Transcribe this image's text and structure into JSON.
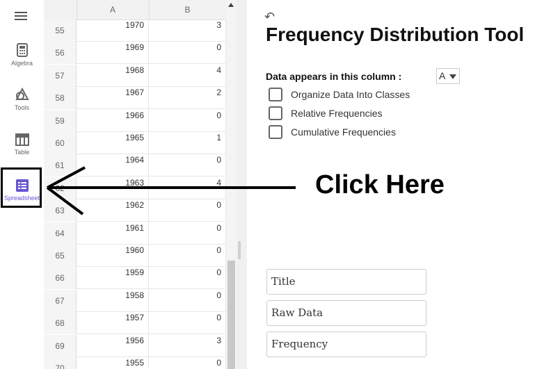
{
  "toolbar": {
    "items": [
      {
        "label": "Algebra",
        "icon": "calculator-icon"
      },
      {
        "label": "Tools",
        "icon": "shapes-icon"
      },
      {
        "label": "Table",
        "icon": "table-icon"
      },
      {
        "label": "Spreadsheet",
        "icon": "spreadsheet-icon"
      }
    ],
    "active": "Spreadsheet",
    "accent": "#6557d2"
  },
  "spreadsheet": {
    "columns": [
      "A",
      "B"
    ],
    "rows": [
      {
        "n": "55",
        "a": "1970",
        "b": "3"
      },
      {
        "n": "56",
        "a": "1969",
        "b": "0"
      },
      {
        "n": "57",
        "a": "1968",
        "b": "4"
      },
      {
        "n": "58",
        "a": "1967",
        "b": "2"
      },
      {
        "n": "59",
        "a": "1966",
        "b": "0"
      },
      {
        "n": "60",
        "a": "1965",
        "b": "1"
      },
      {
        "n": "61",
        "a": "1964",
        "b": "0"
      },
      {
        "n": "62",
        "a": "1963",
        "b": "4"
      },
      {
        "n": "63",
        "a": "1962",
        "b": "0"
      },
      {
        "n": "64",
        "a": "1961",
        "b": "0"
      },
      {
        "n": "65",
        "a": "1960",
        "b": "0"
      },
      {
        "n": "66",
        "a": "1959",
        "b": "0"
      },
      {
        "n": "67",
        "a": "1958",
        "b": "0"
      },
      {
        "n": "68",
        "a": "1957",
        "b": "0"
      },
      {
        "n": "69",
        "a": "1956",
        "b": "3"
      },
      {
        "n": "70",
        "a": "1955",
        "b": "0"
      }
    ]
  },
  "tool": {
    "title": "Frequency Distribution Tool",
    "column_prompt": "Data appears in this column :",
    "column_selected": "A",
    "checkboxes": [
      {
        "label": "Organize Data Into Classes",
        "checked": false
      },
      {
        "label": "Relative Frequencies",
        "checked": false
      },
      {
        "label": "Cumulative Frequencies",
        "checked": false
      }
    ],
    "fields": [
      {
        "value": "Title"
      },
      {
        "value": "Raw Data"
      },
      {
        "value": "Frequency"
      }
    ]
  },
  "annotation": {
    "text": "Click Here"
  }
}
